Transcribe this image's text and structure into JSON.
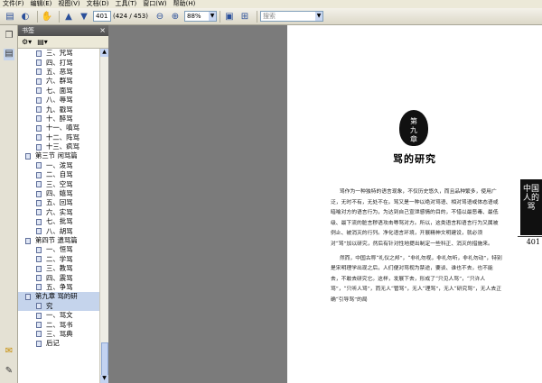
{
  "menu": [
    "文件(F)",
    "编辑(E)",
    "视图(V)",
    "文档(D)",
    "工具(T)",
    "窗口(W)",
    "帮助(H)"
  ],
  "toolbar": {
    "page_value": "401",
    "page_count": "(424 / 453)",
    "zoom_value": "88%",
    "search_placeholder": "搜索"
  },
  "bookmarks_panel": {
    "title": "书签",
    "items": [
      {
        "label": "三、咒骂",
        "level": 2
      },
      {
        "label": "四、打骂",
        "level": 2
      },
      {
        "label": "五、恶骂",
        "level": 2
      },
      {
        "label": "六、群骂",
        "level": 2
      },
      {
        "label": "七、面骂",
        "level": 2
      },
      {
        "label": "八、辱骂",
        "level": 2
      },
      {
        "label": "九、戳骂",
        "level": 2
      },
      {
        "label": "十、醉骂",
        "level": 2
      },
      {
        "label": "十一、嗔骂",
        "level": 2
      },
      {
        "label": "十二、阵骂",
        "level": 2
      },
      {
        "label": "十三、疯骂",
        "level": 2
      },
      {
        "label": "第三节 闲骂篇",
        "level": 1
      },
      {
        "label": "一、泼骂",
        "level": 2
      },
      {
        "label": "二、自骂",
        "level": 2
      },
      {
        "label": "三、空骂",
        "level": 2
      },
      {
        "label": "四、嬉骂",
        "level": 2
      },
      {
        "label": "五、回骂",
        "level": 2
      },
      {
        "label": "六、实骂",
        "level": 2
      },
      {
        "label": "七、批骂",
        "level": 2
      },
      {
        "label": "八、胡骂",
        "level": 2
      },
      {
        "label": "第四节 遗骂篇",
        "level": 1
      },
      {
        "label": "一、恒骂",
        "level": 2
      },
      {
        "label": "二、学骂",
        "level": 2
      },
      {
        "label": "三、教骂",
        "level": 2
      },
      {
        "label": "四、震骂",
        "level": 2
      },
      {
        "label": "五、争骂",
        "level": 2
      },
      {
        "label": "第九章  骂的研",
        "level": 1,
        "selected": true
      },
      {
        "label": "究",
        "level": 2,
        "selected": true
      },
      {
        "label": "一、骂文",
        "level": 2
      },
      {
        "label": "二、骂书",
        "level": 2
      },
      {
        "label": "三、骂典",
        "level": 2
      },
      {
        "label": "后记",
        "level": 2
      }
    ]
  },
  "page": {
    "emblem_line1": "第",
    "emblem_line2": "九",
    "emblem_line3": "章",
    "chapter_title": "骂的研究",
    "side_mark": "中国人的骂",
    "page_number": "401",
    "paragraphs": [
      "骂作为一种独特的语言现象，不仅历史悠久，而且品种繁多，使用广泛，无时不有，无处不在。骂又是一种以绝对骂语、相对骂语或体态语或暗喻对方的语言行为，为达到自己宣泄感情的目的，不惜以最恶毒、最低级、最下流的脏言秽语攻击辱骂对方。所以，这类语言和语言行为又属被例止、被消灭的行列。净化语言环境，开展精神文明建设，就必须对“骂”加以研究，然后有针对性地提出制定一些科正、消灭的措施来。",
      "然而，中国古称“礼仪之邦”，“非礼勿视，非礼勿听，非礼勿动”，特别是宋明理学出现之后，人们便对骂视为禁途，要谈、谁也不去，也不能去，不敢去研究它。这样，发展下去，形成了“只见人骂”，“只许人骂”，“只听人骂”，而无人“管骂”，无人“理骂”，无人“研究骂”，无人去正确“引导骂”的局"
    ]
  }
}
